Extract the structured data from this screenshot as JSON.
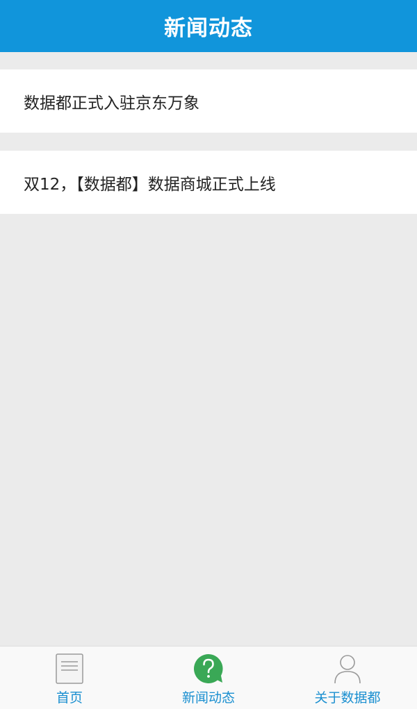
{
  "header": {
    "title": "新闻动态"
  },
  "news": {
    "items": [
      {
        "title": "数据都正式入驻京东万象"
      },
      {
        "title": "双12，【数据都】数据商城正式上线"
      }
    ]
  },
  "tabbar": {
    "tabs": [
      {
        "label": "首页",
        "icon": "document-icon"
      },
      {
        "label": "新闻动态",
        "icon": "question-bubble-icon",
        "active": true
      },
      {
        "label": "关于数据都",
        "icon": "person-icon"
      }
    ]
  },
  "colors": {
    "header_bg": "#1195db",
    "page_bg": "#ebebeb",
    "tab_label": "#1a8fd0",
    "active_icon": "#3aa856"
  }
}
